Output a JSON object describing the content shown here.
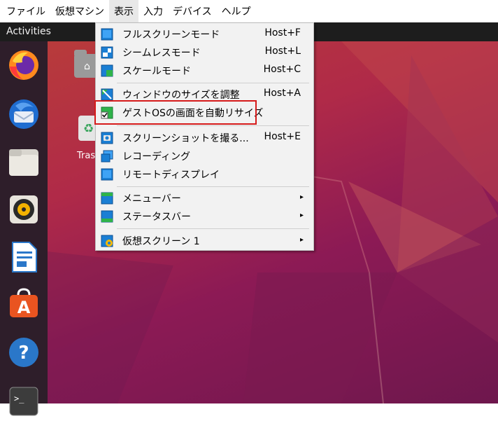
{
  "vbox_menubar": {
    "items": [
      "ファイル",
      "仮想マシン",
      "表示",
      "入力",
      "デバイス",
      "ヘルプ"
    ],
    "active_index": 2
  },
  "ubuntu_topbar": {
    "activities_label": "Activities"
  },
  "desktop": {
    "trash_label": "Tras"
  },
  "dock": {
    "apps": [
      "firefox-icon",
      "thunderbird-icon",
      "files-icon",
      "rhythmbox-icon",
      "libreoffice-writer-icon",
      "ubuntu-software-icon",
      "help-icon",
      "terminal-icon"
    ]
  },
  "view_menu": {
    "items": [
      {
        "label": "フルスクリーンモード",
        "shortcut": "Host+F"
      },
      {
        "label": "シームレスモード",
        "shortcut": "Host+L"
      },
      {
        "label": "スケールモード",
        "shortcut": "Host+C"
      },
      {
        "label": "ウィンドウのサイズを調整",
        "shortcut": "Host+A"
      },
      {
        "label": "ゲストOSの画面を自動リサイズ",
        "shortcut": ""
      },
      {
        "label": "スクリーンショットを撮る...",
        "shortcut": "Host+E"
      },
      {
        "label": "レコーディング",
        "shortcut": ""
      },
      {
        "label": "リモートディスプレイ",
        "shortcut": ""
      },
      {
        "label": "メニューバー",
        "shortcut": ""
      },
      {
        "label": "ステータスバー",
        "shortcut": ""
      },
      {
        "label": "仮想スクリーン 1",
        "shortcut": ""
      }
    ],
    "highlight_color": "#d61b1b",
    "icon_color": "#1a7fd4"
  }
}
